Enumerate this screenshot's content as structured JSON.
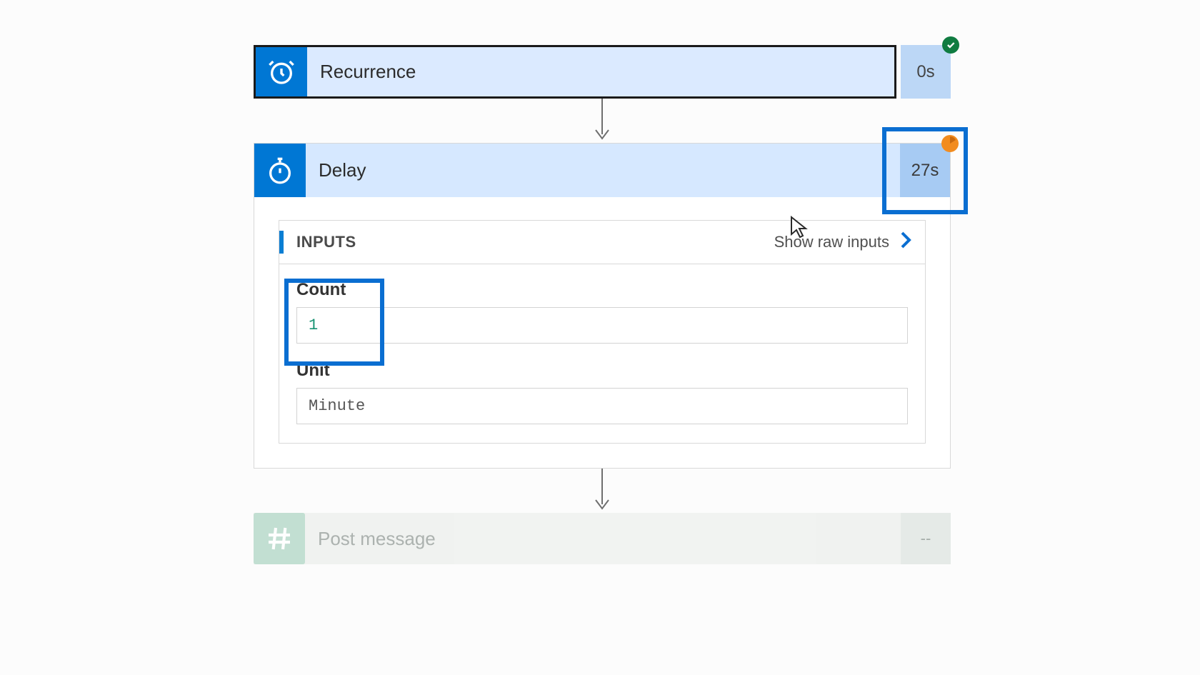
{
  "steps": {
    "recurrence": {
      "title": "Recurrence",
      "duration": "0s",
      "status": "success"
    },
    "delay": {
      "title": "Delay",
      "duration": "27s",
      "status": "running",
      "inputs_label": "INPUTS",
      "show_raw_label": "Show raw inputs",
      "fields": {
        "count": {
          "label": "Count",
          "value": "1"
        },
        "unit": {
          "label": "Unit",
          "value": "Minute"
        }
      }
    },
    "post_message": {
      "title": "Post message",
      "duration": "--"
    }
  },
  "colors": {
    "brand_blue": "#0077d4",
    "annotation_blue": "#0a6ed1",
    "success_green": "#107c41",
    "running_orange": "#f28c1f"
  }
}
